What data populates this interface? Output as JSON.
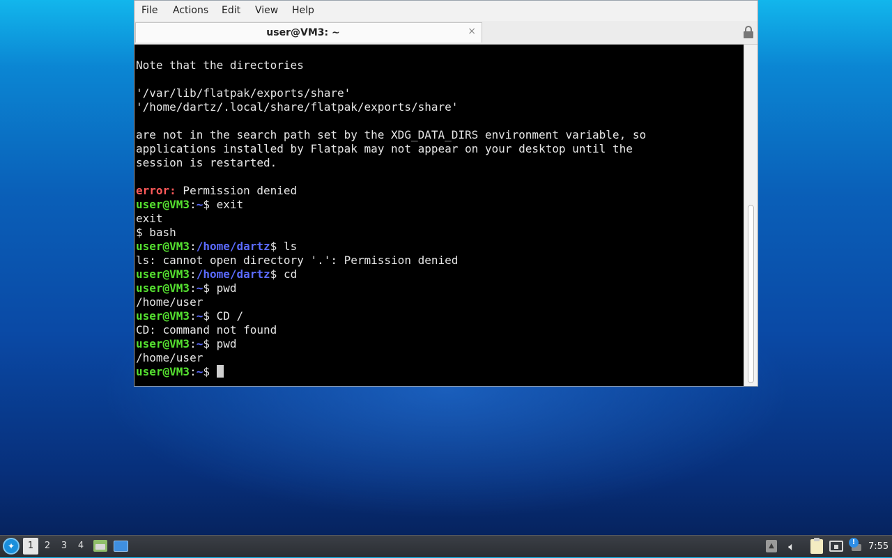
{
  "window": {
    "menu": [
      "File",
      "Actions",
      "Edit",
      "View",
      "Help"
    ],
    "tab_title": "user@VM3: ~",
    "tab_close": "×"
  },
  "terminal": {
    "lines": [
      [
        {
          "t": "Note that the directories",
          "c": ""
        }
      ],
      [
        {
          "t": "",
          "c": ""
        }
      ],
      [
        {
          "t": "'/var/lib/flatpak/exports/share'",
          "c": ""
        }
      ],
      [
        {
          "t": "'/home/dartz/.local/share/flatpak/exports/share'",
          "c": ""
        }
      ],
      [
        {
          "t": "",
          "c": ""
        }
      ],
      [
        {
          "t": "are not in the search path set by the XDG_DATA_DIRS environment variable, so",
          "c": ""
        }
      ],
      [
        {
          "t": "applications installed by Flatpak may not appear on your desktop until the",
          "c": ""
        }
      ],
      [
        {
          "t": "session is restarted.",
          "c": ""
        }
      ],
      [
        {
          "t": "",
          "c": ""
        }
      ],
      [
        {
          "t": "error:",
          "c": "err"
        },
        {
          "t": " Permission denied",
          "c": ""
        }
      ],
      [
        {
          "t": "user@VM3",
          "c": "p-user"
        },
        {
          "t": ":",
          "c": ""
        },
        {
          "t": "~",
          "c": "p-path"
        },
        {
          "t": "$ exit",
          "c": ""
        }
      ],
      [
        {
          "t": "exit",
          "c": ""
        }
      ],
      [
        {
          "t": "$ bash",
          "c": ""
        }
      ],
      [
        {
          "t": "user@VM3",
          "c": "p-user"
        },
        {
          "t": ":",
          "c": ""
        },
        {
          "t": "/home/dartz",
          "c": "p-path"
        },
        {
          "t": "$ ls",
          "c": ""
        }
      ],
      [
        {
          "t": "ls: cannot open directory '.': Permission denied",
          "c": ""
        }
      ],
      [
        {
          "t": "user@VM3",
          "c": "p-user"
        },
        {
          "t": ":",
          "c": ""
        },
        {
          "t": "/home/dartz",
          "c": "p-path"
        },
        {
          "t": "$ cd",
          "c": ""
        }
      ],
      [
        {
          "t": "user@VM3",
          "c": "p-user"
        },
        {
          "t": ":",
          "c": ""
        },
        {
          "t": "~",
          "c": "p-path"
        },
        {
          "t": "$ pwd",
          "c": ""
        }
      ],
      [
        {
          "t": "/home/user",
          "c": ""
        }
      ],
      [
        {
          "t": "user@VM3",
          "c": "p-user"
        },
        {
          "t": ":",
          "c": ""
        },
        {
          "t": "~",
          "c": "p-path"
        },
        {
          "t": "$ CD /",
          "c": ""
        }
      ],
      [
        {
          "t": "CD: command not found",
          "c": ""
        }
      ],
      [
        {
          "t": "user@VM3",
          "c": "p-user"
        },
        {
          "t": ":",
          "c": ""
        },
        {
          "t": "~",
          "c": "p-path"
        },
        {
          "t": "$ pwd",
          "c": ""
        }
      ],
      [
        {
          "t": "/home/user",
          "c": ""
        }
      ],
      [
        {
          "t": "user@VM3",
          "c": "p-user"
        },
        {
          "t": ":",
          "c": ""
        },
        {
          "t": "~",
          "c": "p-path"
        },
        {
          "t": "$ ",
          "c": ""
        }
      ]
    ],
    "colors": {
      "background": "#000000",
      "text": "#e6e6e6",
      "prompt_user": "#55e030",
      "prompt_path": "#5b6bff",
      "error": "#ff5a5a"
    }
  },
  "taskbar": {
    "workspaces": [
      "1",
      "2",
      "3",
      "4"
    ],
    "active_workspace": "1",
    "icons": [
      "start-menu-icon",
      "file-manager-icon",
      "show-desktop-icon",
      "tray-arrow-icon",
      "volume-icon",
      "clipboard-icon",
      "network-icon",
      "notification-icon"
    ],
    "clock": "7:55"
  }
}
